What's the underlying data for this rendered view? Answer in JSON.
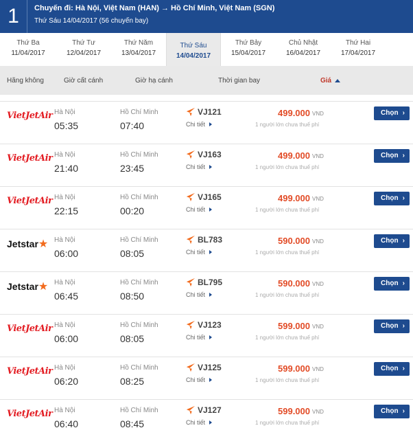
{
  "header": {
    "step": "1",
    "route": "Chuyến đi: Hà Nội, Việt Nam (HAN) → Hồ Chí Minh, Việt Nam (SGN)",
    "subtitle": "Thứ Sáu 14/04/2017 (56 chuyến bay)"
  },
  "days": [
    {
      "name": "Thứ Ba",
      "date": "11/04/2017"
    },
    {
      "name": "Thứ Tư",
      "date": "12/04/2017"
    },
    {
      "name": "Thứ Năm",
      "date": "13/04/2017"
    },
    {
      "name": "Thứ Sáu",
      "date": "14/04/2017",
      "active": true
    },
    {
      "name": "Thứ Bảy",
      "date": "15/04/2017"
    },
    {
      "name": "Chủ Nhật",
      "date": "16/04/2017"
    },
    {
      "name": "Thứ Hai",
      "date": "17/04/2017"
    }
  ],
  "columns": {
    "airline": "Hãng không",
    "depart": "Giờ cất cánh",
    "arrive": "Giờ hạ cánh",
    "duration": "Thời gian bay",
    "price": "Giá"
  },
  "common": {
    "from_city": "Hà Nội",
    "to_city": "Hồ Chí Minh",
    "detail_label": "Chi tiết",
    "currency": "VND",
    "price_note": "1 người lớn chưa thuế phí",
    "select_label": "Chọn"
  },
  "logos": {
    "vietjet": "VietJetAir",
    "jetstar": "Jetstar"
  },
  "accent_color": "#1e4b8f",
  "price_color": "#e24b26",
  "flights": [
    {
      "airline": "vietjet",
      "depart": "05:35",
      "arrive": "07:40",
      "code": "VJ121",
      "price": "499.000"
    },
    {
      "airline": "vietjet",
      "depart": "21:40",
      "arrive": "23:45",
      "code": "VJ163",
      "price": "499.000"
    },
    {
      "airline": "vietjet",
      "depart": "22:15",
      "arrive": "00:20",
      "code": "VJ165",
      "price": "499.000"
    },
    {
      "airline": "jetstar",
      "depart": "06:00",
      "arrive": "08:05",
      "code": "BL783",
      "price": "590.000"
    },
    {
      "airline": "jetstar",
      "depart": "06:45",
      "arrive": "08:50",
      "code": "BL795",
      "price": "590.000"
    },
    {
      "airline": "vietjet",
      "depart": "06:00",
      "arrive": "08:05",
      "code": "VJ123",
      "price": "599.000"
    },
    {
      "airline": "vietjet",
      "depart": "06:20",
      "arrive": "08:25",
      "code": "VJ125",
      "price": "599.000"
    },
    {
      "airline": "vietjet",
      "depart": "06:40",
      "arrive": "08:45",
      "code": "VJ127",
      "price": "599.000"
    }
  ]
}
